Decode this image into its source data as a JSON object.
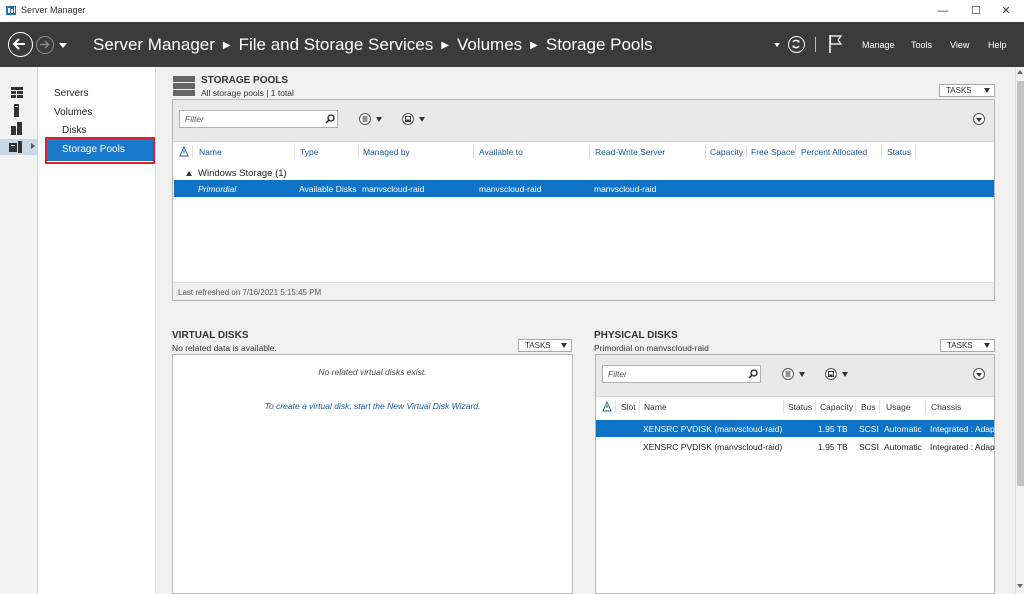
{
  "window": {
    "title": "Server Manager",
    "controls": {
      "minimize": "—",
      "maximize": "☐",
      "close": "✕"
    }
  },
  "header": {
    "breadcrumb": [
      "Server Manager",
      "File and Storage Services",
      "Volumes",
      "Storage Pools"
    ],
    "menu": {
      "manage": "Manage",
      "tools": "Tools",
      "view": "View",
      "help": "Help"
    }
  },
  "nav": {
    "items": [
      {
        "label": "Servers"
      },
      {
        "label": "Volumes"
      },
      {
        "label": "Disks"
      },
      {
        "label": "Storage Pools",
        "selected": true
      }
    ]
  },
  "storage_pools": {
    "title": "STORAGE POOLS",
    "subtitle": "All storage pools | 1 total",
    "tasks_label": "TASKS",
    "filter_placeholder": "Filter",
    "columns": [
      "Name",
      "Type",
      "Managed by",
      "Available to",
      "Read-Write Server",
      "Capacity",
      "Free Space",
      "Percent Allocated",
      "Status"
    ],
    "group_label": "Windows Storage (1)",
    "rows": [
      {
        "name": "Primordial",
        "type": "Available Disks",
        "managed_by": "manvscloud-raid",
        "available_to": "manvscloud-raid",
        "rw_server": "manvscloud-raid",
        "selected": true
      }
    ],
    "last_refreshed": "Last refreshed on 7/16/2021 5:15:45 PM"
  },
  "virtual_disks": {
    "title": "VIRTUAL DISKS",
    "subtitle": "No related data is available.",
    "tasks_label": "TASKS",
    "empty_message": "No related virtual disks exist.",
    "create_link": "To create a virtual disk, start the New Virtual Disk Wizard."
  },
  "physical_disks": {
    "title": "PHYSICAL DISKS",
    "subtitle": "Primordial on manvscloud-raid",
    "tasks_label": "TASKS",
    "filter_placeholder": "Filter",
    "columns": [
      "Slot",
      "Name",
      "Status",
      "Capacity",
      "Bus",
      "Usage",
      "Chassis"
    ],
    "rows": [
      {
        "name": "XENSRC PVDISK (manvscloud-raid)",
        "capacity": "1.95 TB",
        "bus": "SCSI",
        "usage": "Automatic",
        "chassis": "Integrated : Adap",
        "selected": true
      },
      {
        "name": "XENSRC PVDISK (manvscloud-raid)",
        "capacity": "1.95 TB",
        "bus": "SCSI",
        "usage": "Automatic",
        "chassis": "Integrated : Adap",
        "selected": false
      }
    ]
  },
  "colors": {
    "header_bg": "#3b3b3b",
    "selection": "#0e73c7",
    "nav_selection": "#1979ca",
    "highlight_box": "#e0202a",
    "link": "#1a5aa0"
  }
}
